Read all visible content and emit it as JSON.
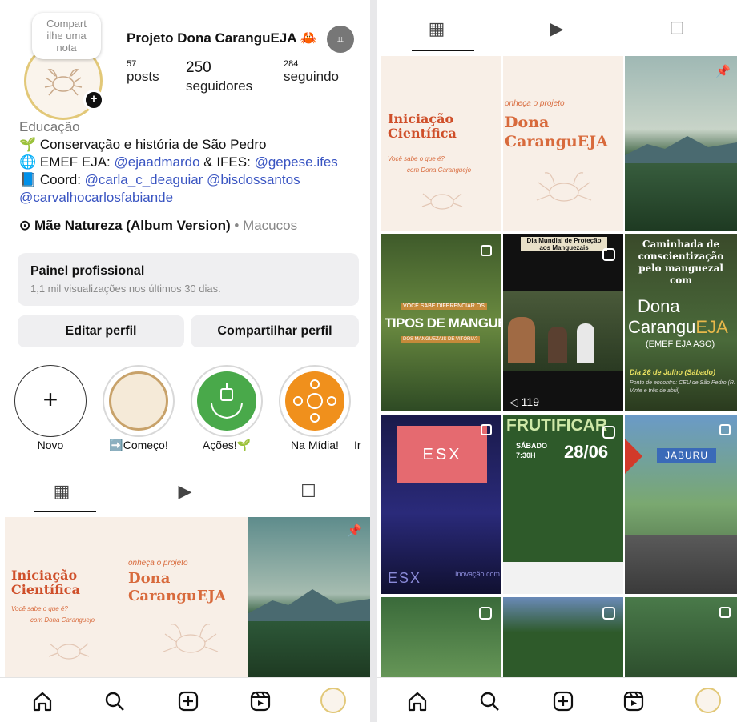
{
  "profile": {
    "note": "Compart\nilhe uma\nnota",
    "name": "Projeto Dona CaranguEJA",
    "crab": "🦀",
    "posts_num": "57",
    "posts_label": "posts",
    "followers_num": "250",
    "followers_label": "seguidores",
    "following_num": "284",
    "following_label": "seguindo"
  },
  "bio": {
    "category": "Educação",
    "line1": "Conservação e história de São Pedro",
    "line2_prefix": "EMEF EJA: ",
    "line2_link1": "@ejaadmardo",
    "line2_mid": " & IFES: ",
    "line2_link2": "@gepese.ifes",
    "line3_prefix": "Coord: ",
    "line3_link1": "@carla_c_deaguiar",
    "line3_link2": "@bisdossantos",
    "line4_link": "@carvalhocarlosfabiande"
  },
  "music": {
    "song": "Mãe Natureza (Album Version)",
    "sep": " • ",
    "artist": "Macucos"
  },
  "pro_panel": {
    "title": "Painel profissional",
    "subtitle": "1,1 mil visualizações nos últimos 30 dias."
  },
  "buttons": {
    "edit": "Editar perfil",
    "share": "Compartilhar perfil"
  },
  "highlights": [
    {
      "label": "Novo"
    },
    {
      "label": "Começo!"
    },
    {
      "label": "Ações!"
    },
    {
      "label": "Na Mídia!"
    },
    {
      "label": "Ir"
    }
  ],
  "posts": {
    "sci_title": "Iniciação Científica",
    "sci_sub": "Você sabe o que é?",
    "sci_sub2": "com Dona Caranguejo",
    "dona_pre": "onheça o projeto",
    "dona_title": "Dona",
    "dona_title2": "CaranguEJA",
    "mangue_small": "VOCÊ SABE DIFERENCIAR OS",
    "mangue_big": "TIPOS DE MANGUE",
    "mangue_foot": "DOS MANGUEZAIS DE VITÓRIA?",
    "dia_mundial": "Dia Mundial de Proteção aos Manguezais",
    "views": "119",
    "walk_title": "Caminhada de conscientização pelo manguezal com",
    "walk_dona": "Dona",
    "walk_cara": "Carangu",
    "walk_eja": "EJA",
    "walk_emef": "(EMEF EJA ASO)",
    "walk_date": "Dia 26 de Julho (Sábado)",
    "walk_meet": "Ponto de encontro: CEU de São Pedro (R. Vinte e três de abril)",
    "esx": "ESX",
    "esx_sub": "Inovação com",
    "frut_title": "FRUTIFICAR",
    "frut_day": "SÁBADO",
    "frut_time": "7:30H",
    "frut_date": "28/06",
    "jaburu": "JABURU"
  },
  "colors": {
    "accent_blue": "#3a55c2",
    "orange": "#cf4f2a",
    "ring": "#e2c878"
  }
}
